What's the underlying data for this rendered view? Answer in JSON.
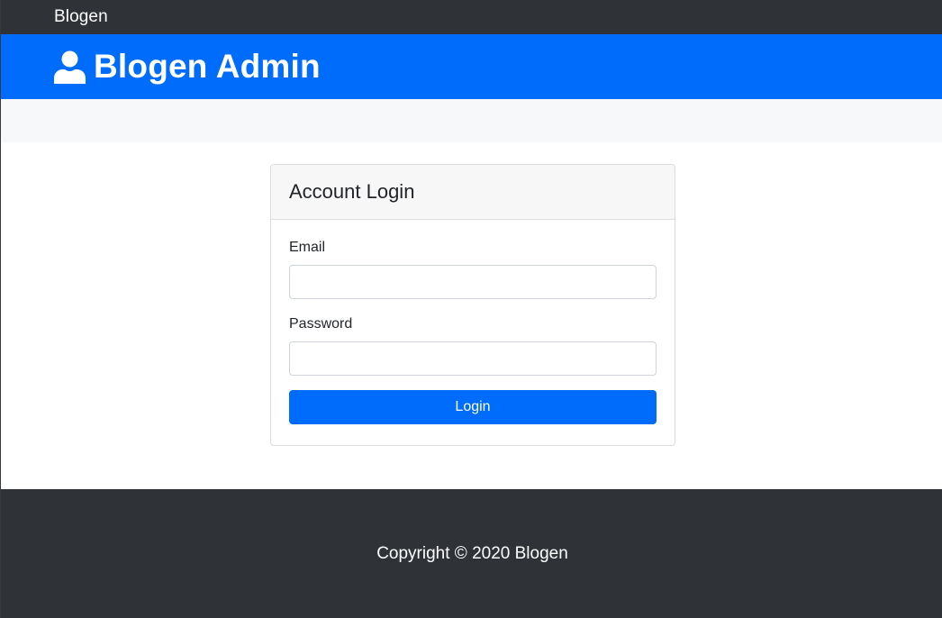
{
  "navbar": {
    "brand": "Blogen"
  },
  "header": {
    "icon": "user-icon",
    "title": "Blogen Admin"
  },
  "login_card": {
    "title": "Account Login",
    "email_label": "Email",
    "email_value": "",
    "password_label": "Password",
    "password_value": "",
    "submit_label": "Login"
  },
  "footer": {
    "copyright": "Copyright © 2020 Blogen"
  },
  "colors": {
    "navbar_bg": "#2f3338",
    "header_bg": "#006cfb",
    "primary": "#006cfb",
    "action_bar_bg": "#f7f8f9",
    "footer_bg": "#2f3338"
  }
}
